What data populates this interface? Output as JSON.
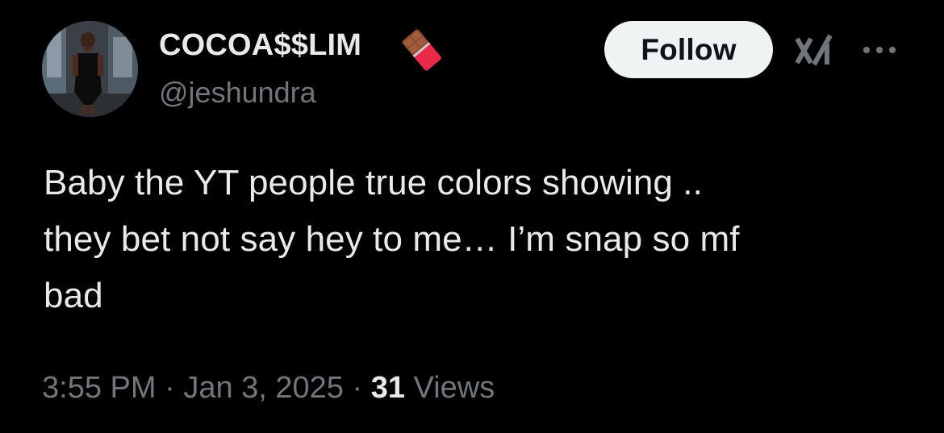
{
  "user": {
    "display_name": "COCOA$$LIM",
    "handle": "@jeshundra",
    "name_emoji": "chocolate-bar-emoji",
    "avatar": "profile-photo"
  },
  "header": {
    "follow_label": "Follow",
    "grok_icon": "grok-icon",
    "more_icon": "more-icon"
  },
  "tweet": {
    "lines": [
      "Baby the YT people true colors showing ..",
      "they bet not say hey to me… I’m snap so mf",
      "bad"
    ]
  },
  "meta": {
    "time": "3:55 PM",
    "separator1": " · ",
    "date": "Jan 3, 2025",
    "separator2": " · ",
    "views_count": "31",
    "views_label": " Views"
  },
  "colors": {
    "background": "#000000",
    "primary_text": "#e7e9ea",
    "secondary_text": "#71767b",
    "follow_button_bg": "#eff3f4",
    "follow_button_text": "#0f1419"
  }
}
